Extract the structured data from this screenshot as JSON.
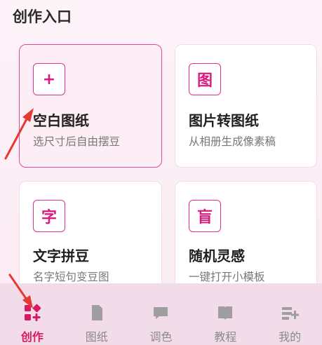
{
  "section_title": "创作入口",
  "cards": [
    {
      "icon_text": "+",
      "icon_name": "plus-icon",
      "title": "空白图纸",
      "desc": "选尺寸后自由摆豆",
      "selected": true
    },
    {
      "icon_text": "图",
      "icon_name": "image-glyph-icon",
      "title": "图片转图纸",
      "desc": "从相册生成像素稿",
      "selected": false
    },
    {
      "icon_text": "字",
      "icon_name": "text-glyph-icon",
      "title": "文字拼豆",
      "desc": "名字短句变豆图",
      "selected": false
    },
    {
      "icon_text": "盲",
      "icon_name": "blind-box-glyph-icon",
      "title": "随机灵感",
      "desc": "一键打开小模板",
      "selected": false
    }
  ],
  "tabs": [
    {
      "label": "创作",
      "icon": "create-grid-icon",
      "active": true
    },
    {
      "label": "图纸",
      "icon": "document-icon",
      "active": false
    },
    {
      "label": "调色",
      "icon": "chat-bubble-icon",
      "active": false
    },
    {
      "label": "教程",
      "icon": "book-icon",
      "active": false
    },
    {
      "label": "我的",
      "icon": "profile-list-icon",
      "active": false
    }
  ],
  "colors": {
    "accent": "#e0318c",
    "active_tab": "#d81b60",
    "inactive_tab": "#8a8a8a",
    "tabbar_bg": "#f3dcea",
    "pointer": "#e53935"
  }
}
